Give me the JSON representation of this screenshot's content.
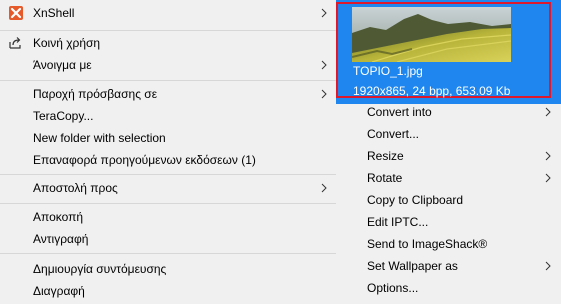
{
  "main_menu": {
    "items": [
      {
        "label": "XnShell",
        "icon": "xnshell-icon",
        "submenu": true
      },
      {
        "label": "Κοινή χρήση",
        "icon": "share-icon",
        "submenu": false
      },
      {
        "label": "Άνοιγμα με",
        "submenu": true
      },
      {
        "label": "Παροχή πρόσβασης σε",
        "submenu": true
      },
      {
        "label": "TeraCopy...",
        "submenu": false
      },
      {
        "label": "New folder with selection",
        "submenu": false
      },
      {
        "label": "Επαναφορά προηγούμενων εκδόσεων (1)",
        "submenu": false
      },
      {
        "label": "Αποστολή προς",
        "submenu": true
      },
      {
        "label": "Αποκοπή",
        "submenu": false
      },
      {
        "label": "Αντιγραφή",
        "submenu": false
      },
      {
        "label": "Δημιουργία συντόμευσης",
        "submenu": false
      },
      {
        "label": "Διαγραφή",
        "submenu": false
      }
    ]
  },
  "xnshell_submenu": {
    "preview": {
      "filename": "TOPIO_1.jpg",
      "info": "1920x865, 24 bpp, 653.09 Kb"
    },
    "items": [
      {
        "label": "Convert into",
        "submenu": true
      },
      {
        "label": "Convert...",
        "submenu": false
      },
      {
        "label": "Resize",
        "submenu": true
      },
      {
        "label": "Rotate",
        "submenu": true
      },
      {
        "label": "Copy to Clipboard",
        "submenu": false
      },
      {
        "label": "Edit IPTC...",
        "submenu": false
      },
      {
        "label": "Send to ImageShack®",
        "submenu": false
      },
      {
        "label": "Set Wallpaper as",
        "submenu": true
      },
      {
        "label": "Options...",
        "submenu": false
      }
    ]
  },
  "colors": {
    "menu_background": "#f0f0f0",
    "highlight": "#1e86ee",
    "preview_border": "#e0182c",
    "separator": "#d7d7d7"
  }
}
